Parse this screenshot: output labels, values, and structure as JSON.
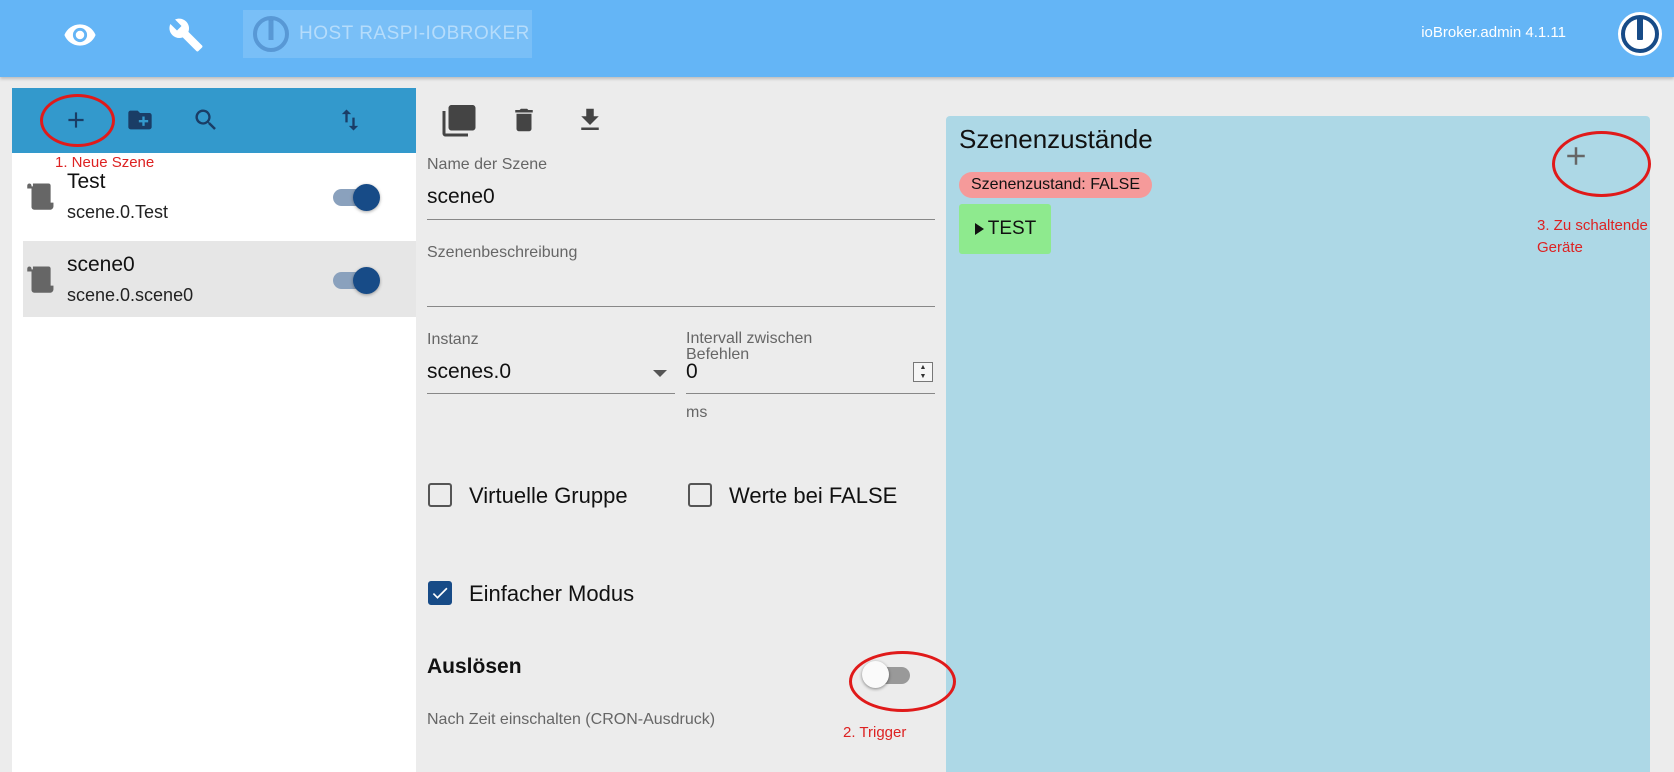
{
  "header": {
    "host_label": "HOST RASPI-IOBROKER",
    "version": "ioBroker.admin 4.1.11"
  },
  "icons": {
    "eye": "eye-icon",
    "wrench": "wrench-icon",
    "add": "plus-icon",
    "new_folder": "folder-plus-icon",
    "search": "search-icon",
    "sort": "sort-icon",
    "copy": "copy-icon",
    "delete": "trash-icon",
    "export": "download-icon",
    "scene": "scroll-icon"
  },
  "scenes": [
    {
      "name": "Test",
      "id": "scene.0.Test",
      "enabled": true
    },
    {
      "name": "scene0",
      "id": "scene.0.scene0",
      "enabled": true
    }
  ],
  "form": {
    "name_label": "Name der Szene",
    "name_value": "scene0",
    "description_label": "Szenenbeschreibung",
    "description_value": "",
    "instance_label": "Instanz",
    "instance_value": "scenes.0",
    "interval_label": "Intervall zwischen Befehlen",
    "interval_value": "0",
    "interval_unit": "ms",
    "virtual_group_label": "Virtuelle Gruppe",
    "virtual_group_checked": false,
    "values_false_label": "Werte bei FALSE",
    "values_false_checked": false,
    "simple_mode_label": "Einfacher Modus",
    "simple_mode_checked": true,
    "trigger_heading": "Auslösen",
    "cron_label": "Nach Zeit einschalten (CRON-Ausdruck)",
    "cron_enabled": false
  },
  "states": {
    "title": "Szenenzustände",
    "chip": "Szenenzustand: FALSE",
    "test_button": "TEST"
  },
  "annotations": {
    "new_scene": "1. Neue Szene",
    "trigger": "2. Trigger",
    "devices_line1": "3. Zu schaltende",
    "devices_line2": "Geräte"
  },
  "colors": {
    "topbar": "#64b5f6",
    "toolbar": "#3399cc",
    "accent": "#174b87",
    "states_panel": "#add8e6",
    "chip_false": "#f59a9a",
    "test_button": "#8eea8e",
    "annotation": "#e01a1a"
  }
}
